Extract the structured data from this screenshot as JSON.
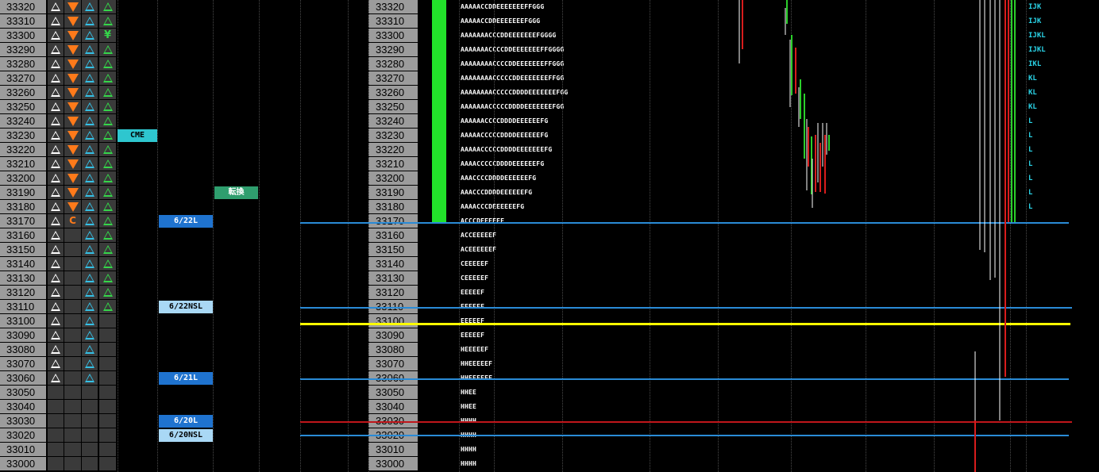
{
  "ladder": {
    "prices": [
      "33320",
      "33310",
      "33300",
      "33290",
      "33280",
      "33270",
      "33260",
      "33250",
      "33240",
      "33230",
      "33220",
      "33210",
      "33200",
      "33190",
      "33180",
      "33170",
      "33160",
      "33150",
      "33140",
      "33130",
      "33120",
      "33110",
      "33100",
      "33090",
      "33080",
      "33070",
      "33060",
      "33050",
      "33040",
      "33030",
      "33020",
      "33010",
      "33000"
    ],
    "icons": [
      [
        "white-up-triangle",
        "orange-down-triangle",
        "cyan-up-triangle",
        "green-up-triangle"
      ],
      [
        "white-up-triangle",
        "orange-down-triangle",
        "cyan-up-triangle",
        "green-up-triangle"
      ],
      [
        "white-up-triangle",
        "orange-down-triangle",
        "cyan-up-triangle",
        "green-yen-glyph"
      ],
      [
        "white-up-triangle",
        "orange-down-triangle",
        "cyan-up-triangle",
        "green-up-triangle"
      ],
      [
        "white-up-triangle",
        "orange-down-triangle",
        "cyan-up-triangle",
        "green-up-triangle"
      ],
      [
        "white-up-triangle",
        "orange-down-triangle",
        "cyan-up-triangle",
        "green-up-triangle"
      ],
      [
        "white-up-triangle",
        "orange-down-triangle",
        "cyan-up-triangle",
        "green-up-triangle"
      ],
      [
        "white-up-triangle",
        "orange-down-triangle",
        "cyan-up-triangle",
        "green-up-triangle"
      ],
      [
        "white-up-triangle",
        "orange-down-triangle",
        "cyan-up-triangle",
        "green-up-triangle"
      ],
      [
        "white-up-triangle",
        "orange-down-triangle",
        "cyan-up-triangle",
        "green-up-triangle"
      ],
      [
        "white-up-triangle",
        "orange-down-triangle",
        "cyan-up-triangle",
        "green-up-triangle"
      ],
      [
        "white-up-triangle",
        "orange-down-triangle",
        "cyan-up-triangle",
        "green-up-triangle"
      ],
      [
        "white-up-triangle",
        "orange-down-triangle",
        "cyan-up-triangle",
        "green-up-triangle"
      ],
      [
        "white-up-triangle",
        "orange-down-triangle",
        "cyan-up-triangle",
        "green-up-triangle"
      ],
      [
        "white-up-triangle",
        "orange-down-triangle",
        "cyan-up-triangle",
        "green-up-triangle"
      ],
      [
        "white-up-triangle",
        "orange-c-glyph",
        "cyan-up-triangle",
        "green-up-triangle"
      ],
      [
        "white-up-triangle",
        "",
        "cyan-up-triangle",
        "green-up-triangle"
      ],
      [
        "white-up-triangle",
        "",
        "cyan-up-triangle",
        "green-up-triangle"
      ],
      [
        "white-up-triangle",
        "",
        "cyan-up-triangle",
        "green-up-triangle"
      ],
      [
        "white-up-triangle",
        "",
        "cyan-up-triangle",
        "green-up-triangle"
      ],
      [
        "white-up-triangle",
        "",
        "cyan-up-triangle",
        "green-up-triangle"
      ],
      [
        "white-up-triangle",
        "",
        "cyan-up-triangle",
        "green-up-triangle"
      ],
      [
        "white-up-triangle",
        "",
        "cyan-up-triangle",
        ""
      ],
      [
        "white-up-triangle",
        "",
        "cyan-up-triangle",
        ""
      ],
      [
        "white-up-triangle",
        "",
        "cyan-up-triangle",
        ""
      ],
      [
        "white-up-triangle",
        "",
        "cyan-up-triangle",
        ""
      ],
      [
        "white-up-triangle",
        "",
        "cyan-up-triangle",
        ""
      ],
      [
        "",
        "",
        "",
        ""
      ],
      [
        "",
        "",
        "",
        ""
      ],
      [
        "",
        "",
        "",
        ""
      ],
      [
        "",
        "",
        "",
        ""
      ],
      [
        "",
        "",
        "",
        ""
      ],
      [
        "",
        "",
        "",
        ""
      ]
    ],
    "glyphs": {
      "yen": "¥",
      "c": "C"
    },
    "tpo": [
      "AAAAACCDDEEEEEEEFFGGG",
      "AAAAACCDDEEEEEEEFGGG",
      "AAAAAAACCCDDEEEEEEEFGGGG",
      "AAAAAAACCCCDDEEEEEEEFFGGGG",
      "AAAAAAAACCCCDDEEEEEEEFFGGG",
      "AAAAAAAACCCCCDDEEEEEEEFFGG",
      "AAAAAAAACCCCCDDDDEEEEEEEFGG",
      "AAAAAAACCCCCDDDDEEEEEEEFGG",
      "AAAAAACCCCDDDDEEEEEEFG",
      "AAAAACCCCCDDDDEEEEEEFG",
      "AAAAACCCCCDDDDEEEEEEEFG",
      "AAAACCCCCDDDDEEEEEEFG",
      "AAACCCCDDDDEEEEEEFG",
      "AAACCCDDDDEEEEEEFG",
      "AAAACCCDEEEEEEFG",
      "ACCCDEEEEEF",
      "ACCEEEEEF",
      "ACEEEEEEF",
      "CEEEEEF",
      "CEEEEEF",
      "EEEEEF",
      "EEEEEF",
      "EEEEEF",
      "EEEEEF",
      "HEEEEEF",
      "HHEEEEEF",
      "HHEEEEEF",
      "HHEE",
      "HHEE",
      "HHHH",
      "HHHH",
      "HHHH",
      "HHHH"
    ],
    "letters": [
      "IJK",
      "IJK",
      "IJKL",
      "IJKL",
      "IKL",
      "KL",
      "KL",
      "KL",
      "L",
      "L",
      "L",
      "L",
      "L",
      "L",
      "L",
      "",
      "",
      "",
      "",
      "",
      "",
      "",
      "",
      "",
      "",
      "",
      "",
      "",
      "",
      "",
      "",
      "",
      ""
    ]
  },
  "tags": [
    {
      "id": "cme",
      "text": "CME",
      "color": "#2ec6cf",
      "textColor": "#000"
    },
    {
      "id": "tenkan",
      "text": "転換",
      "color": "#2f9e6e",
      "textColor": "#fff"
    },
    {
      "id": "d622l",
      "text": "6/22L",
      "color": "#1f73cf",
      "textColor": "#fff"
    },
    {
      "id": "d622nsl",
      "text": "6/22NSL",
      "color": "#a9d8f5",
      "textColor": "#000"
    },
    {
      "id": "d621l",
      "text": "6/21L",
      "color": "#1f73cf",
      "textColor": "#fff"
    },
    {
      "id": "d620l",
      "text": "6/20L",
      "color": "#1f73cf",
      "textColor": "#fff"
    },
    {
      "id": "d620nsl",
      "text": "6/20NSL",
      "color": "#a9d8f5",
      "textColor": "#000"
    }
  ],
  "colors": {
    "blue_level": "#2a8bd6",
    "yellow_level": "#ffff00",
    "red_level": "#c0161b",
    "green_bar": "#22e22a"
  }
}
